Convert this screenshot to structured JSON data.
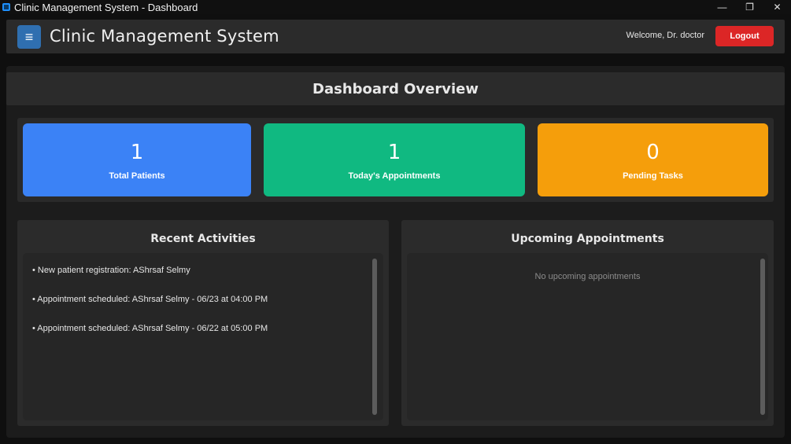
{
  "window": {
    "title": "Clinic Management System - Dashboard",
    "controls": {
      "minimize": "—",
      "restore": "❐",
      "close": "✕"
    }
  },
  "header": {
    "menu_icon": "≡",
    "title": "Clinic Management System",
    "welcome": "Welcome, Dr. doctor",
    "logout_label": "Logout"
  },
  "overview": {
    "title": "Dashboard Overview"
  },
  "stats": [
    {
      "value": "1",
      "label": "Total Patients",
      "color": "#3b82f6"
    },
    {
      "value": "1",
      "label": "Today's Appointments",
      "color": "#10b981"
    },
    {
      "value": "0",
      "label": "Pending Tasks",
      "color": "#f59e0b"
    }
  ],
  "recent_activities": {
    "title": "Recent Activities",
    "items": [
      "• New patient registration: AShrsaf Selmy",
      "• Appointment scheduled: AShrsaf Selmy - 06/23 at 04:00 PM",
      "• Appointment scheduled: AShrsaf Selmy - 06/22 at 05:00 PM"
    ]
  },
  "upcoming_appointments": {
    "title": "Upcoming Appointments",
    "empty_message": "No upcoming appointments"
  },
  "colors": {
    "menu_button": "#2f6fb0",
    "logout_button": "#dc2626",
    "background": "#0f0f0f",
    "panel": "#2b2b2b"
  }
}
